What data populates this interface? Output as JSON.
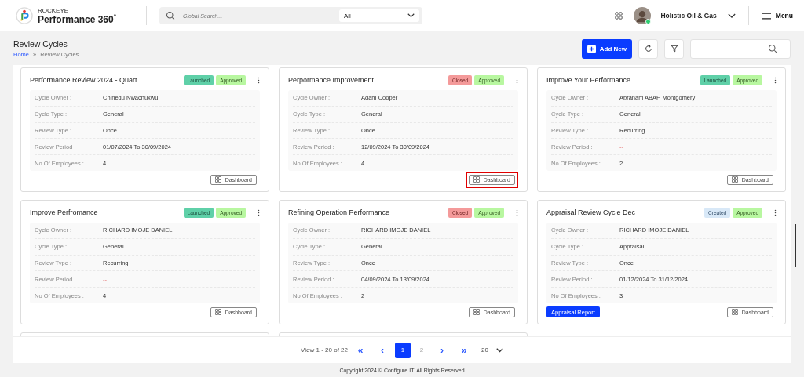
{
  "header": {
    "brand_top": "ROCKEYE",
    "brand_name": "Performance 360",
    "brand_mark": "°",
    "search_placeholder": "Global Search...",
    "search_scope": "All",
    "organization": "Holistic Oil & Gas",
    "menu_label": "Menu"
  },
  "page": {
    "title": "Review Cycles",
    "breadcrumb": [
      {
        "label": "Home",
        "link": true
      },
      {
        "label": "Review Cycles",
        "link": false
      }
    ],
    "breadcrumb_separator": "»",
    "add_button": "Add New"
  },
  "cards": [
    {
      "title": "Performance Review 2024 - Quart...",
      "badges": [
        {
          "label": "Launched",
          "kind": "launched"
        },
        {
          "label": "Approved",
          "kind": "approved"
        }
      ],
      "fields": [
        {
          "label": "Cycle Owner :",
          "value": "Chinedu Nwachukwu",
          "empty": false
        },
        {
          "label": "Cycle Type :",
          "value": "General",
          "empty": false
        },
        {
          "label": "Review Type :",
          "value": "Once",
          "empty": false
        },
        {
          "label": "Review Period :",
          "value": "01/07/2024 To 30/09/2024",
          "empty": false
        },
        {
          "label": "No Of Employees :",
          "value": "4",
          "empty": false
        }
      ],
      "dashboard": {
        "label": "Dashboard",
        "highlighted": false
      }
    },
    {
      "title": "Perpormance Improvement",
      "badges": [
        {
          "label": "Closed",
          "kind": "closed"
        },
        {
          "label": "Approved",
          "kind": "approved"
        }
      ],
      "fields": [
        {
          "label": "Cycle Owner :",
          "value": "Adam Cooper",
          "empty": false
        },
        {
          "label": "Cycle Type :",
          "value": "General",
          "empty": false
        },
        {
          "label": "Review Type :",
          "value": "Once",
          "empty": false
        },
        {
          "label": "Review Period :",
          "value": "12/09/2024 To 30/09/2024",
          "empty": false
        },
        {
          "label": "No Of Employees :",
          "value": "4",
          "empty": false
        }
      ],
      "dashboard": {
        "label": "Dashboard",
        "highlighted": true
      }
    },
    {
      "title": "Improve Your Performance",
      "badges": [
        {
          "label": "Launched",
          "kind": "launched"
        },
        {
          "label": "Approved",
          "kind": "approved"
        }
      ],
      "fields": [
        {
          "label": "Cycle Owner :",
          "value": "Abraham ABAH Montgomery",
          "empty": false
        },
        {
          "label": "Cycle Type :",
          "value": "General",
          "empty": false
        },
        {
          "label": "Review Type :",
          "value": "Recurring",
          "empty": false
        },
        {
          "label": "Review Period :",
          "value": "--",
          "empty": true
        },
        {
          "label": "No Of Employees :",
          "value": "2",
          "empty": false
        }
      ],
      "dashboard": {
        "label": "Dashboard",
        "highlighted": false
      }
    },
    {
      "title": "Improve Perfromance",
      "badges": [
        {
          "label": "Launched",
          "kind": "launched"
        },
        {
          "label": "Approved",
          "kind": "approved"
        }
      ],
      "fields": [
        {
          "label": "Cycle Owner :",
          "value": "RICHARD IMOJE DANIEL",
          "empty": false
        },
        {
          "label": "Cycle Type :",
          "value": "General",
          "empty": false
        },
        {
          "label": "Review Type :",
          "value": "Recurring",
          "empty": false
        },
        {
          "label": "Review Period :",
          "value": "--",
          "empty": true
        },
        {
          "label": "No Of Employees :",
          "value": "4",
          "empty": false
        }
      ],
      "dashboard": {
        "label": "Dashboard",
        "highlighted": false
      }
    },
    {
      "title": "Refining Operation Performance",
      "badges": [
        {
          "label": "Closed",
          "kind": "closed"
        },
        {
          "label": "Approved",
          "kind": "approved"
        }
      ],
      "fields": [
        {
          "label": "Cycle Owner :",
          "value": "RICHARD IMOJE DANIEL",
          "empty": false
        },
        {
          "label": "Cycle Type :",
          "value": "General",
          "empty": false
        },
        {
          "label": "Review Type :",
          "value": "Once",
          "empty": false
        },
        {
          "label": "Review Period :",
          "value": "04/09/2024 To 13/09/2024",
          "empty": false
        },
        {
          "label": "No Of Employees :",
          "value": "2",
          "empty": false
        }
      ],
      "dashboard": {
        "label": "Dashboard",
        "highlighted": false
      }
    },
    {
      "title": "Appraisal Review Cycle Dec",
      "badges": [
        {
          "label": "Created",
          "kind": "created"
        },
        {
          "label": "Approved",
          "kind": "approved"
        }
      ],
      "fields": [
        {
          "label": "Cycle Owner :",
          "value": "RICHARD IMOJE DANIEL",
          "empty": false
        },
        {
          "label": "Cycle Type :",
          "value": "Appraisal",
          "empty": false
        },
        {
          "label": "Review Type :",
          "value": "Once",
          "empty": false
        },
        {
          "label": "Review Period :",
          "value": "01/12/2024 To 31/12/2024",
          "empty": false
        },
        {
          "label": "No Of Employees :",
          "value": "3",
          "empty": false
        }
      ],
      "report_button": "Appraisal Report",
      "dashboard": {
        "label": "Dashboard",
        "highlighted": false
      }
    }
  ],
  "pagination": {
    "summary": "View 1 - 20 of 22",
    "first": "«",
    "prev": "‹",
    "pages": [
      {
        "label": "1",
        "selected": true
      },
      {
        "label": "2",
        "selected": false
      }
    ],
    "next": "›",
    "last": "»",
    "page_size": "20"
  },
  "footer": "Copyright 2024 © Configure.IT. All Rights Reserved"
}
